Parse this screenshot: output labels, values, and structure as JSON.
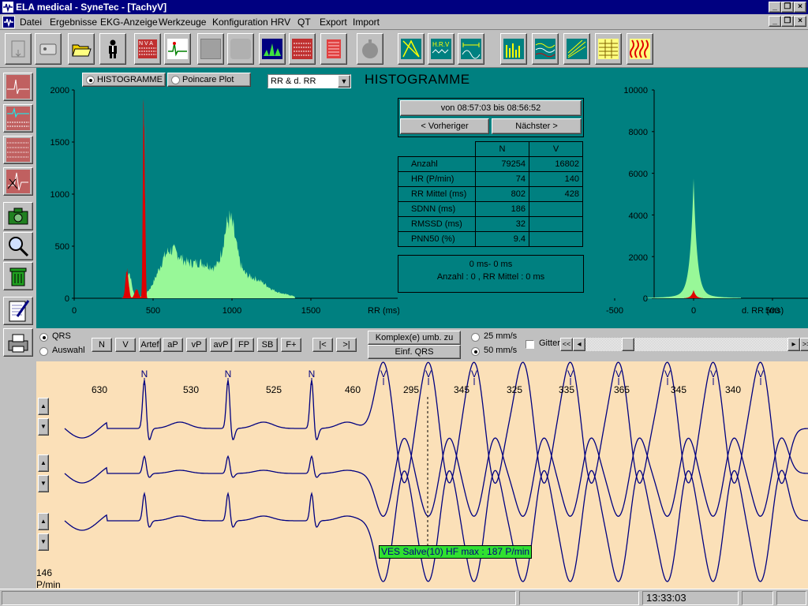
{
  "window": {
    "title": "ELA medical - SyneTec - [TachyV]",
    "minimize": "_",
    "restore": "❐",
    "close": "×"
  },
  "menu": [
    "Datei",
    "Ergebnisse",
    "EKG-Anzeige",
    "Werkzeuge",
    "Konfiguration",
    "HRV",
    "QT",
    "Export",
    "Import"
  ],
  "histogram": {
    "tab_histogramme": "HISTOGRAMME",
    "tab_poincare": "Poincare Plot",
    "combo_value": "RR & d. RR",
    "title": "HISTOGRAMME",
    "left_chart": {
      "y_ticks": [
        "2000",
        "1500",
        "1000",
        "500",
        "0"
      ],
      "x_ticks": [
        "0",
        "500",
        "1000",
        "1500"
      ],
      "x_label": "RR (ms)"
    },
    "right_chart": {
      "y_ticks": [
        "10000",
        "8000",
        "6000",
        "4000",
        "2000",
        "0"
      ],
      "x_ticks": [
        "-500",
        "0",
        "500"
      ],
      "x_label": "d. RR (ms)"
    },
    "colors": {
      "normal": "#98f898",
      "ventricular": "#e00000",
      "panel": "#008080"
    }
  },
  "range": {
    "text": "von  08:57:03   bis  08:56:52",
    "prev": "< Vorheriger",
    "next": "Nächster >"
  },
  "stats": {
    "col_n": "N",
    "col_v": "V",
    "rows": [
      {
        "label": "Anzahl",
        "n": "79254",
        "v": "16802"
      },
      {
        "label": "HR (P/min)",
        "n": "74",
        "v": "140"
      },
      {
        "label": "RR Mittel (ms)",
        "n": "802",
        "v": "428"
      },
      {
        "label": "SDNN (ms)",
        "n": "186",
        "v": ""
      },
      {
        "label": "RMSSD (ms)",
        "n": "32",
        "v": ""
      },
      {
        "label": "PNN50 (%)",
        "n": "9.4",
        "v": ""
      }
    ],
    "selection_line1": "0 ms- 0 ms",
    "selection_line2": "Anzahl : 0 , RR Mittel : 0 ms"
  },
  "controls": {
    "radio_qrs": "QRS",
    "radio_auswahl": "Auswahl",
    "beat_buttons": [
      "N",
      "V",
      "Artef",
      "aP",
      "vP",
      "avP",
      "FP",
      "SB",
      "F+"
    ],
    "nav_first": "|<",
    "nav_last": ">|",
    "komplex": "Komplex(e) umb. zu",
    "einf": "Einf. QRS",
    "speed_25": "25 mm/s",
    "speed_50": "50 mm/s",
    "gitter": "Gitter",
    "scroll_left2": "<<",
    "scroll_left": "◂",
    "scroll_right": "▸",
    "scroll_right2": ">>"
  },
  "ecg": {
    "rr_values": [
      "630",
      "530",
      "525",
      "460",
      "295",
      "345",
      "325",
      "335",
      "365",
      "345",
      "340"
    ],
    "beat_labels": [
      "N",
      "N",
      "N",
      "V",
      "V",
      "V",
      "V",
      "V",
      "V",
      "V",
      "V"
    ],
    "event_label": "VES Salve(10) HF max : 187 P/min",
    "hr_value": "146",
    "hr_unit": "P/min",
    "trace_color": "#000080"
  },
  "status": {
    "time": "13:33:03"
  }
}
